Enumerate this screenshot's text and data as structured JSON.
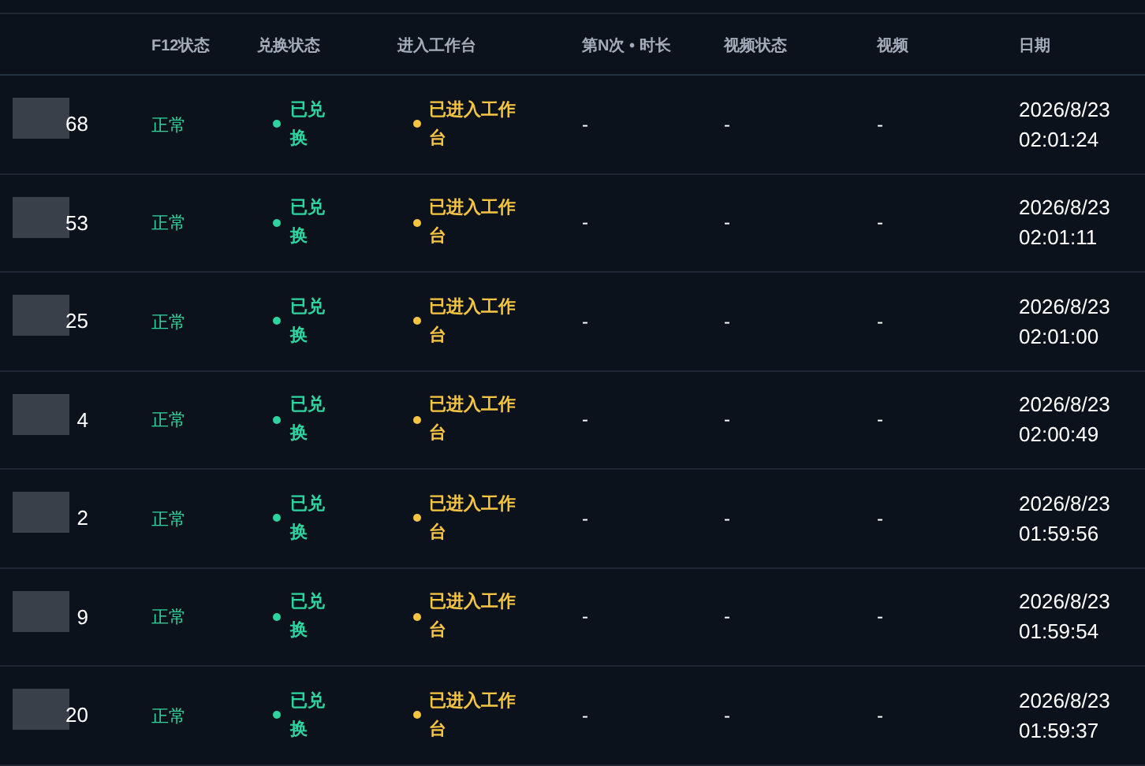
{
  "table": {
    "columns": [
      "F12状态",
      "兑换状态",
      "进入工作台",
      "第N次 • 时长",
      "视频状态",
      "视频",
      "日期"
    ],
    "rows": [
      {
        "column_1": "68",
        "f12": "正常",
        "exchange": "已兑换",
        "workbench": "已进入工作台",
        "count": "-",
        "video_status": "-",
        "video": "-",
        "date": "2026/8/23 02:01:24"
      },
      {
        "column_1": "53",
        "f12": "正常",
        "exchange": "已兑换",
        "workbench": "已进入工作台",
        "count": "-",
        "video_status": "-",
        "video": "-",
        "date": "2026/8/23 02:01:11"
      },
      {
        "column_1": "25",
        "f12": "正常",
        "exchange": "已兑换",
        "workbench": "已进入工作台",
        "count": "-",
        "video_status": "-",
        "video": "-",
        "date": "2026/8/23 02:01:00"
      },
      {
        "column_1": "4",
        "f12": "正常",
        "exchange": "已兑换",
        "workbench": "已进入工作台",
        "count": "-",
        "video_status": "-",
        "video": "-",
        "date": "2026/8/23 02:00:49"
      },
      {
        "column_1": "2",
        "f12": "正常",
        "exchange": "已兑换",
        "workbench": "已进入工作台",
        "count": "-",
        "video_status": "-",
        "video": "-",
        "date": "2026/8/23 01:59:56"
      },
      {
        "column_1": "9",
        "f12": "正常",
        "exchange": "已兑换",
        "workbench": "已进入工作台",
        "count": "-",
        "video_status": "-",
        "video": "-",
        "date": "2026/8/23 01:59:54"
      },
      {
        "column_1": "20",
        "f12": "正常",
        "exchange": "已兑换",
        "workbench": "已进入工作台",
        "count": "-",
        "video_status": "-",
        "video": "-",
        "date": "2026/8/23 01:59:37"
      }
    ]
  }
}
